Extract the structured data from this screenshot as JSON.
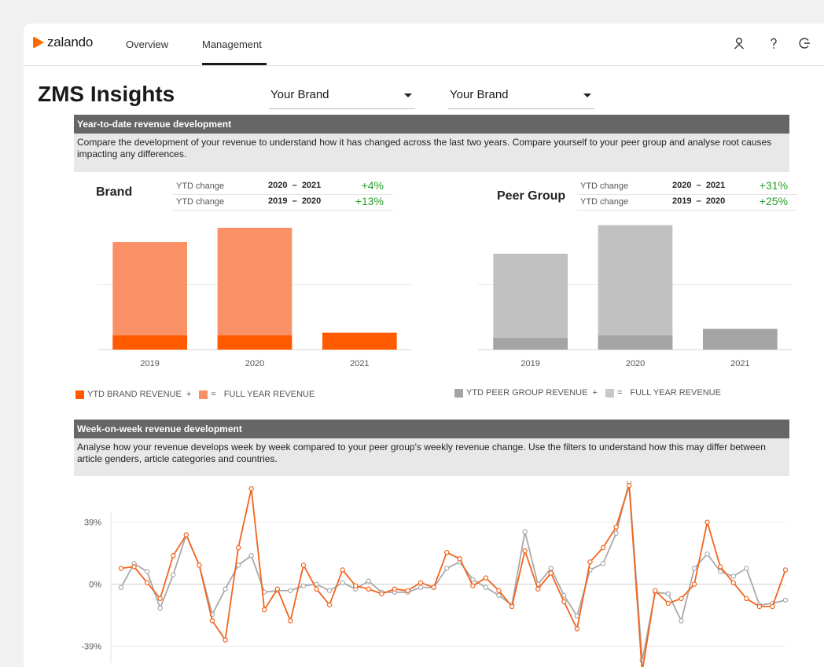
{
  "nav": {
    "logo_text": "zalando",
    "tabs": [
      "Overview",
      "Management"
    ],
    "active_tab": "Management",
    "icons": [
      "user-icon",
      "help-icon",
      "logout-icon"
    ]
  },
  "header": {
    "title": "ZMS Insights",
    "select_1": "Your Brand",
    "select_2": "Your Brand"
  },
  "ytd_section": {
    "title": "Year-to-date revenue development",
    "description": "Compare the development of your revenue to understand how it has changed across the last two years. Compare yourself to your peer group and analyse root causes impacting any differences."
  },
  "brand": {
    "heading": "Brand",
    "rows": [
      {
        "label": "YTD change",
        "years": "2020  –  2021",
        "change": "+4%"
      },
      {
        "label": "YTD change",
        "years": "2019  –  2020",
        "change": "+13%"
      }
    ],
    "legend": {
      "ytd": "YTD BRAND REVENUE  +",
      "eq": "=",
      "full": "FULL YEAR REVENUE"
    }
  },
  "peer": {
    "heading": "Peer Group",
    "rows": [
      {
        "label": "YTD change",
        "years": "2020  –  2021",
        "change": "+31%"
      },
      {
        "label": "YTD change",
        "years": "2019  –  2020",
        "change": "+25%"
      }
    ],
    "legend": {
      "ytd": "YTD PEER GROUP REVENUE  +",
      "eq": "=",
      "full": "FULL YEAR REVENUE"
    }
  },
  "wow_section": {
    "title": "Week-on-week revenue development",
    "description": "Analyse how your revenue develops week by week compared to your peer group's weekly revenue change. Use the filters to understand how this may differ between article genders, article categories and countries."
  },
  "colors": {
    "brand_ytd": "#ff5a00",
    "brand_full": "#f99066",
    "peer_ytd": "#a4a4a4",
    "peer_full": "#c1c1c1",
    "positive": "#27a02a",
    "brand_line": "#f2651e",
    "peer_line": "#a9a9a9"
  },
  "chart_data": [
    {
      "type": "bar",
      "categories": [
        "2019",
        "2020",
        "2021"
      ],
      "series": [
        {
          "name": "YTD BRAND REVENUE",
          "values": [
            11,
            11,
            13
          ]
        },
        {
          "name": "FULL YEAR REVENUE",
          "values": [
            83,
            94,
            null
          ]
        }
      ],
      "ylim": [
        0,
        100
      ]
    },
    {
      "type": "bar",
      "categories": [
        "2019",
        "2020",
        "2021"
      ],
      "series": [
        {
          "name": "YTD PEER GROUP REVENUE",
          "values": [
            9,
            11,
            16
          ]
        },
        {
          "name": "FULL YEAR REVENUE",
          "values": [
            74,
            96,
            null
          ]
        }
      ],
      "ylim": [
        0,
        100
      ]
    },
    {
      "type": "line",
      "ytick_labels": [
        "39%",
        "0%",
        "-39%"
      ],
      "ylim": [
        -52,
        65
      ],
      "series": [
        {
          "name": "Brand",
          "values": [
            10,
            11,
            1,
            -9,
            18,
            31,
            12,
            -23,
            -35,
            23,
            60,
            -16,
            -3,
            -23,
            12,
            -3,
            -13,
            9,
            -1,
            -3,
            -6,
            -3,
            -4,
            1,
            -2,
            20,
            16,
            -1,
            4,
            -4,
            -14,
            21,
            -3,
            7,
            -11,
            -28,
            14,
            23,
            36,
            62,
            -55,
            -4,
            -12,
            -9,
            0,
            39,
            11,
            1,
            -9,
            -14,
            -14,
            9
          ]
        },
        {
          "name": "Peer Group",
          "values": [
            -2,
            13,
            8,
            -15,
            6,
            31,
            12,
            -19,
            -3,
            12,
            18,
            -5,
            -4,
            -4,
            -1,
            0,
            -4,
            1,
            -3,
            2,
            -5,
            -5,
            -5,
            -2,
            -2,
            10,
            14,
            3,
            -2,
            -7,
            -13,
            33,
            0,
            10,
            -7,
            -20,
            9,
            13,
            32,
            64,
            -48,
            -5,
            -6,
            -23,
            10,
            19,
            8,
            5,
            10,
            -13,
            -12,
            -10
          ]
        }
      ]
    }
  ]
}
